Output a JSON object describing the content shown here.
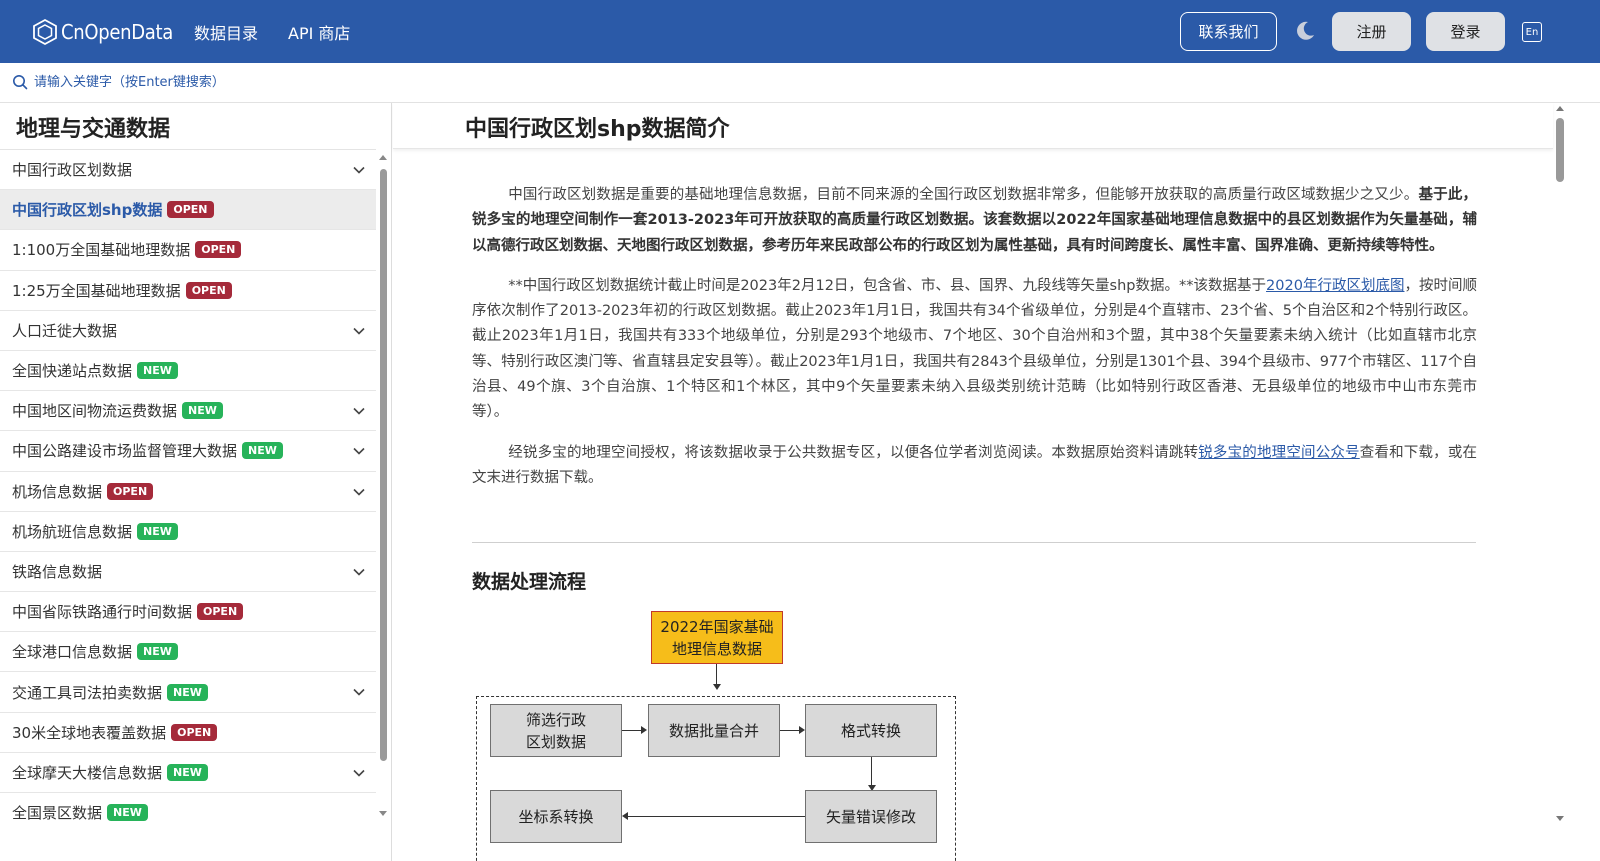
{
  "header": {
    "logo_text": "CnOpenData",
    "nav": [
      "数据目录",
      "API 商店"
    ],
    "contact_label": "联系我们",
    "register_label": "注册",
    "login_label": "登录",
    "lang_label": "En",
    "brand_color": "#2b5aa8"
  },
  "search": {
    "placeholder": "请输入关键字（按Enter键搜索）"
  },
  "sidebar": {
    "title": "地理与交通数据",
    "items": [
      {
        "label": "中国行政区划数据",
        "badge": "",
        "badge_type": "",
        "expandable": true,
        "active": false
      },
      {
        "label": "中国行政区划shp数据",
        "badge": "OPEN",
        "badge_type": "open",
        "expandable": false,
        "active": true
      },
      {
        "label": "1:100万全国基础地理数据",
        "badge": "OPEN",
        "badge_type": "open",
        "expandable": false,
        "active": false
      },
      {
        "label": "1:25万全国基础地理数据",
        "badge": "OPEN",
        "badge_type": "open",
        "expandable": false,
        "active": false
      },
      {
        "label": "人口迁徙大数据",
        "badge": "",
        "badge_type": "",
        "expandable": true,
        "active": false
      },
      {
        "label": "全国快递站点数据",
        "badge": "NEW",
        "badge_type": "new",
        "expandable": false,
        "active": false
      },
      {
        "label": "中国地区间物流运费数据",
        "badge": "NEW",
        "badge_type": "new",
        "expandable": true,
        "active": false
      },
      {
        "label": "中国公路建设市场监督管理大数据",
        "badge": "NEW",
        "badge_type": "new",
        "expandable": true,
        "active": false
      },
      {
        "label": "机场信息数据",
        "badge": "OPEN",
        "badge_type": "open",
        "expandable": true,
        "active": false
      },
      {
        "label": "机场航班信息数据",
        "badge": "NEW",
        "badge_type": "new",
        "expandable": false,
        "active": false
      },
      {
        "label": "铁路信息数据",
        "badge": "",
        "badge_type": "",
        "expandable": true,
        "active": false
      },
      {
        "label": "中国省际铁路通行时间数据",
        "badge": "OPEN",
        "badge_type": "open",
        "expandable": false,
        "active": false
      },
      {
        "label": "全球港口信息数据",
        "badge": "NEW",
        "badge_type": "new",
        "expandable": false,
        "active": false
      },
      {
        "label": "交通工具司法拍卖数据",
        "badge": "NEW",
        "badge_type": "new",
        "expandable": true,
        "active": false
      },
      {
        "label": "30米全球地表覆盖数据",
        "badge": "OPEN",
        "badge_type": "open",
        "expandable": false,
        "active": false
      },
      {
        "label": "全球摩天大楼信息数据",
        "badge": "NEW",
        "badge_type": "new",
        "expandable": true,
        "active": false
      },
      {
        "label": "全国景区数据",
        "badge": "NEW",
        "badge_type": "new",
        "expandable": false,
        "active": false
      }
    ]
  },
  "main": {
    "title": "中国行政区划shp数据简介",
    "para1_normal": "中国行政区划数据是重要的基础地理信息数据，目前不同来源的全国行政区划数据非常多，但能够开放获取的高质量行政区域数据少之又少。",
    "para1_bold": "基于此，锐多宝的地理空间制作一套2013-2023年可开放获取的高质量行政区划数据。该套数据以2022年国家基础地理信息数据中的县区划数据作为矢量基础，辅以高德行政区划数据、天地图行政区划数据，参考历年来民政部公布的行政区划为属性基础，具有时间跨度长、属性丰富、国界准确、更新持续等特性。",
    "para2_before": "**中国行政区划数据统计截止时间是2023年2月12日，包含省、市、县、国界、九段线等矢量shp数据。**该数据基于",
    "para2_link": "2020年行政区划底图",
    "para2_after": "，按时间顺序依次制作了2013-2023年初的行政区划数据。截止2023年1月1日，我国共有34个省级单位，分别是4个直辖市、23个省、5个自治区和2个特别行政区。截止2023年1月1日，我国共有333个地级单位，分别是293个地级市、7个地区、30个自治州和3个盟，其中38个矢量要素未纳入统计（比如直辖市北京等、特别行政区澳门等、省直辖县定安县等）。截止2023年1月1日，我国共有2843个县级单位，分别是1301个县、394个县级市、977个市辖区、117个自治县、49个旗、3个自治旗、1个特区和1个林区，其中9个矢量要素未纳入县级类别统计范畴（比如特别行政区香港、无县级单位的地级市中山市东莞市等）。",
    "para3_before": "经锐多宝的地理空间授权，将该数据收录于公共数据专区，以便各位学者浏览阅读。本数据原始资料请跳转",
    "para3_link": "锐多宝的地理空间公众号",
    "para3_after": "查看和下载，或在文末进行数据下载。",
    "section_title": "数据处理流程",
    "flow": {
      "source": "2022年国家基础\n地理信息数据",
      "step1": "筛选行政\n区划数据",
      "step2": "数据批量合并",
      "step3": "格式转换",
      "step4": "矢量错误修改",
      "step5": "坐标系转换"
    }
  }
}
